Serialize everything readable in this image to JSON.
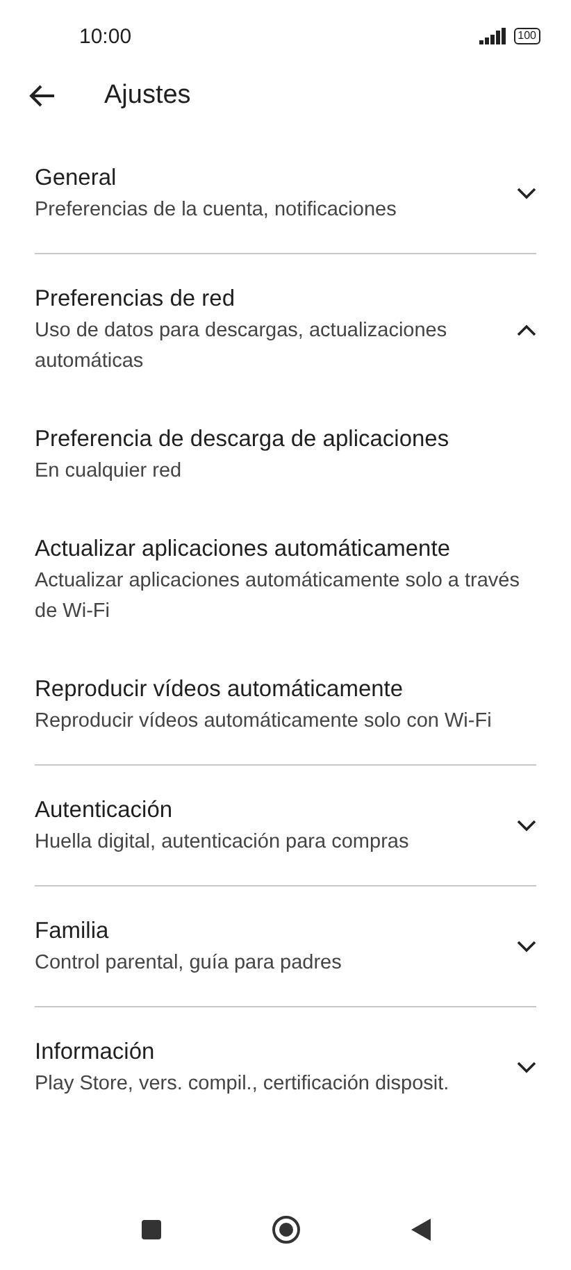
{
  "status_bar": {
    "time": "10:00",
    "battery": "100"
  },
  "header": {
    "title": "Ajustes"
  },
  "sections": [
    {
      "title": "General",
      "subtitle": "Preferencias de la cuenta, notificaciones",
      "expanded": false
    },
    {
      "title": "Preferencias de red",
      "subtitle": "Uso de datos para descargas, actualizaciones automáticas",
      "expanded": true,
      "children": [
        {
          "title": "Preferencia de descarga de aplicaciones",
          "subtitle": "En cualquier red"
        },
        {
          "title": "Actualizar aplicaciones automáticamente",
          "subtitle": "Actualizar aplicaciones automáticamente solo a través de Wi-Fi"
        },
        {
          "title": "Reproducir vídeos automáticamente",
          "subtitle": "Reproducir vídeos automáticamente solo con Wi-Fi"
        }
      ]
    },
    {
      "title": "Autenticación",
      "subtitle": "Huella digital, autenticación para compras",
      "expanded": false
    },
    {
      "title": "Familia",
      "subtitle": "Control parental, guía para padres",
      "expanded": false
    },
    {
      "title": "Información",
      "subtitle": "Play Store, vers. compil., certificación disposit.",
      "expanded": false
    }
  ]
}
